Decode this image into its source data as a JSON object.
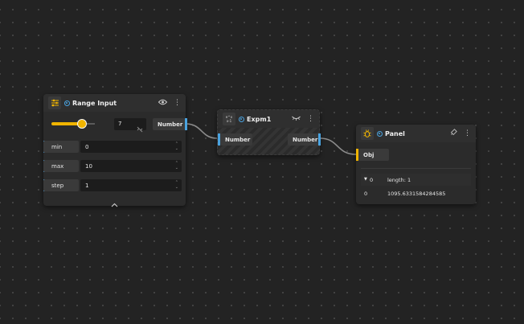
{
  "colors": {
    "accent_yellow": "#f0b400",
    "accent_blue": "#4aa3e0",
    "wire": "#8c8c8c"
  },
  "range_node": {
    "title": "Range Input",
    "header_icons": [
      "sliders-icon",
      "eye-icon",
      "more-vertical-icon"
    ],
    "slider_value": 7,
    "value_text": "7",
    "output_label": "Number",
    "fields": [
      {
        "label": "min",
        "value": "0"
      },
      {
        "label": "max",
        "value": "10"
      },
      {
        "label": "step",
        "value": "1"
      }
    ]
  },
  "expm1_node": {
    "title": "Expm1",
    "icon_text_top": "e^x",
    "icon_text_bottom": "x-1",
    "header_icons": [
      "visibility-off-icon",
      "more-vertical-icon"
    ],
    "input_label": "Number",
    "output_label": "Number"
  },
  "panel_node": {
    "title": "Panel",
    "header_icons": [
      "bug-icon",
      "pin-icon",
      "more-vertical-icon"
    ],
    "input_label": "Obj",
    "rows": [
      {
        "key": "0",
        "value": "length: 1",
        "expanded": true
      },
      {
        "key": "0",
        "value": "1095.6331584284585"
      }
    ]
  }
}
